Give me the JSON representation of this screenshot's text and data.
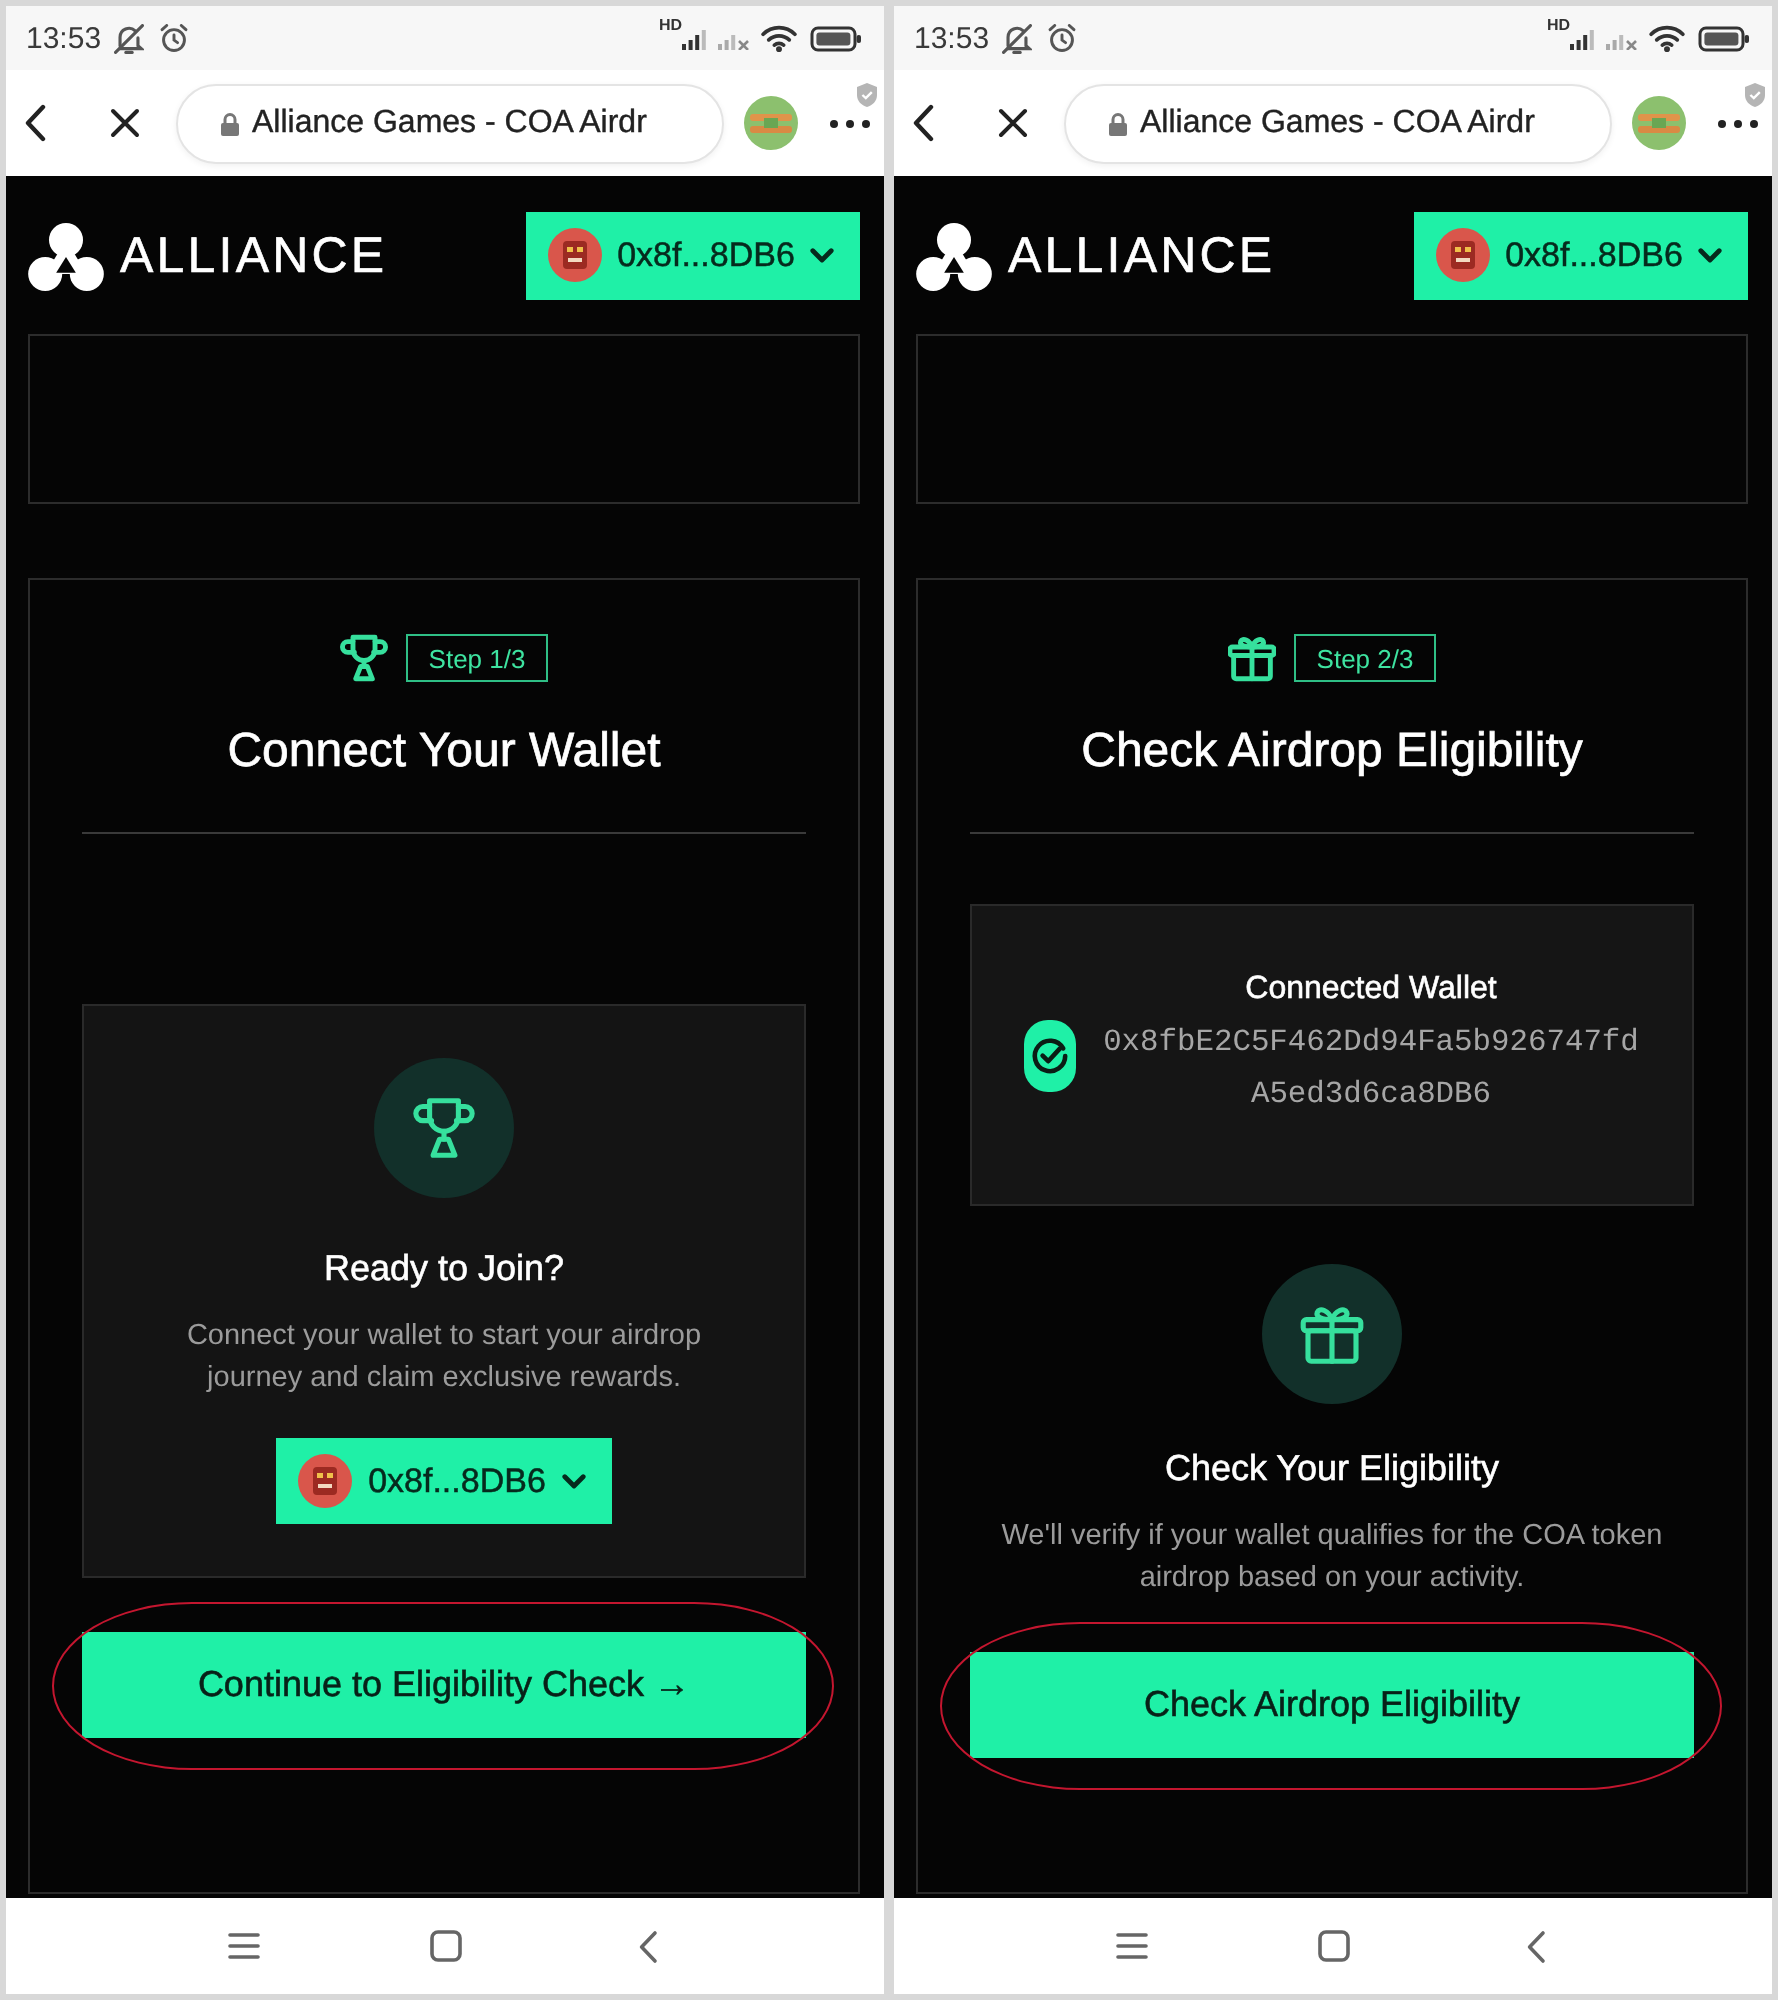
{
  "screens": [
    {
      "kind": "connect",
      "status_bar": {
        "time": "13:53",
        "network_label": "HD"
      },
      "address_bar": {
        "title": "Alliance Games - COA Airdr"
      },
      "header": {
        "logo_text": "ALLIANCE",
        "wallet_button": "0x8f...8DB6"
      },
      "step_badge": "Step 1/3",
      "title": "Connect Your Wallet",
      "blocks": [
        {
          "kind": "feature_card",
          "heading": "Ready to Join?",
          "text": "Connect your wallet to start your airdrop journey and claim exclusive rewards.",
          "wallet_button": "0x8f...8DB6"
        }
      ],
      "primary_button": {
        "label": "Continue to Eligibility Check →",
        "highlighted": true
      }
    },
    {
      "kind": "eligibility",
      "status_bar": {
        "time": "13:53",
        "network_label": "HD"
      },
      "address_bar": {
        "title": "Alliance Games - COA Airdr"
      },
      "header": {
        "logo_text": "ALLIANCE",
        "wallet_button": "0x8f...8DB6"
      },
      "step_badge": "Step 2/3",
      "title": "Check Airdrop Eligibility",
      "blocks": [
        {
          "kind": "wallet_info",
          "heading": "Connected Wallet",
          "address": "0x8fbE2C5F462Dd94Fa5b926747fdA5ed3d6ca8DB6"
        },
        {
          "kind": "feature",
          "heading": "Check Your Eligibility",
          "text": "We'll verify if your wallet qualifies for the COA token airdrop based on your activity."
        }
      ],
      "primary_button": {
        "label": "Check Airdrop Eligibility",
        "highlighted": true
      }
    }
  ]
}
